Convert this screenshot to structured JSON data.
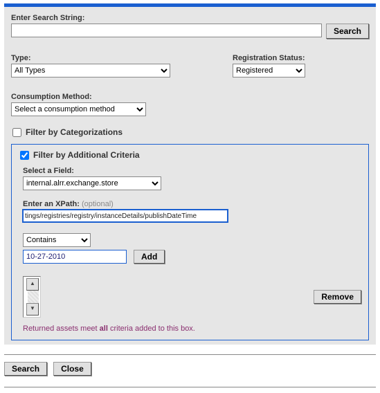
{
  "search": {
    "label": "Enter Search String:",
    "value": "",
    "button": "Search"
  },
  "type": {
    "label": "Type:",
    "selected": "All Types"
  },
  "registration": {
    "label": "Registration Status:",
    "selected": "Registered"
  },
  "consumption": {
    "label": "Consumption Method:",
    "selected": "Select a consumption method"
  },
  "filterCategorizations": {
    "label": "Filter by Categorizations",
    "checked": false
  },
  "filterAdditional": {
    "label": "Filter by Additional Criteria",
    "checked": true,
    "fieldLabel": "Select a Field:",
    "fieldSelected": "internal.alrr.exchange.store",
    "xpathLabel": "Enter an XPath:",
    "xpathOptional": "(optional)",
    "xpathValue": "tings/registries/registry/instanceDetails/publishDateTime",
    "operator": "Contains",
    "valueInput": "10-27-2010",
    "addButton": "Add",
    "removeButton": "Remove",
    "hintPrefix": "Returned assets meet ",
    "hintBold": "all",
    "hintSuffix": " criteria added to this box."
  },
  "bottom": {
    "search": "Search",
    "close": "Close"
  }
}
